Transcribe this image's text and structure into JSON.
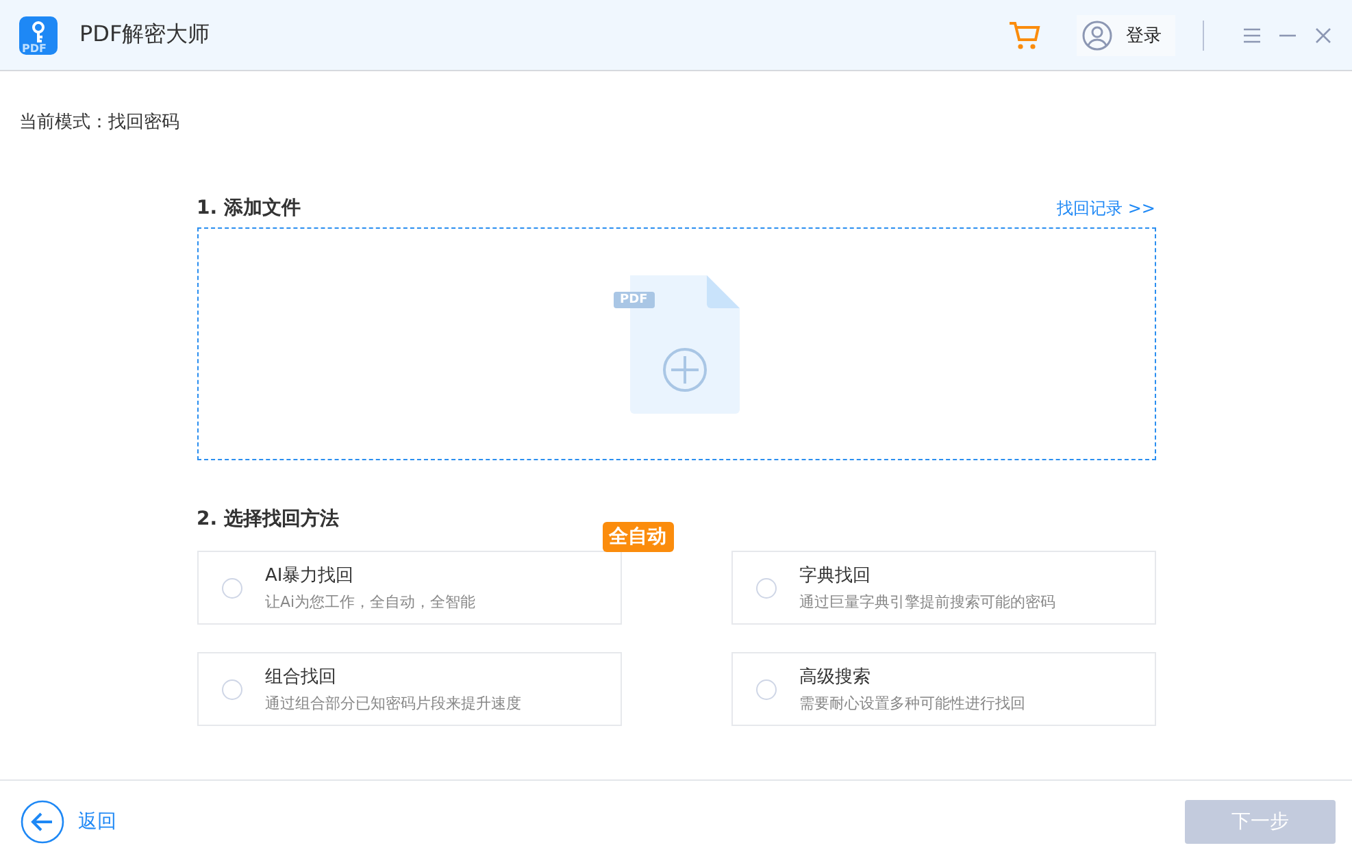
{
  "window": {
    "title": "PDF解密大师",
    "logo_text": "PDF",
    "login": "登录"
  },
  "mode": "当前模式：找回密码",
  "add_file": {
    "title": "1. 添加文件",
    "history_link": "找回记录 >>",
    "file_tag": "PDF"
  },
  "methods_title": "2. 选择找回方法",
  "methods": [
    {
      "name": "AI暴力找回",
      "desc": "让Ai为您工作，全自动，全智能",
      "selected": false,
      "badge": "全自动"
    },
    {
      "name": "字典找回",
      "desc": "通过巨量字典引擎提前搜索可能的密码",
      "selected": false
    },
    {
      "name": "组合找回",
      "desc": "通过组合部分已知密码片段来提升速度",
      "selected": false
    },
    {
      "name": "高级搜索",
      "desc": "需要耐心设置多种可能性进行找回",
      "selected": false
    }
  ],
  "footer": {
    "back": "返回",
    "next": "下一步",
    "next_disabled": true
  }
}
